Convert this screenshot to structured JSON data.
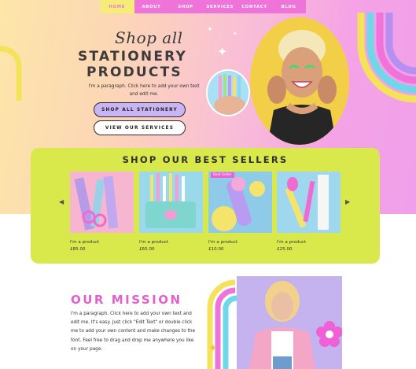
{
  "nav": {
    "items": [
      "HOME",
      "ABOUT",
      "SHOP",
      "SERVICES",
      "CONTACT",
      "BLOG"
    ],
    "active": "HOME"
  },
  "hero": {
    "script_title": "Shop all",
    "title_line1": "STATIONERY",
    "title_line2": "PRODUCTS",
    "paragraph": "I'm a paragraph. Click here to add your own text and edit me.",
    "primary_button": "SHOP ALL STATIONERY",
    "secondary_button": "VIEW OUR SERVICES"
  },
  "best_sellers": {
    "title": "SHOP OUR BEST SELLERS",
    "products": [
      {
        "name": "I'm a product",
        "price": "£85.00",
        "badge": ""
      },
      {
        "name": "I'm a product",
        "price": "£65.00",
        "badge": ""
      },
      {
        "name": "I'm a product",
        "price": "£10.00",
        "badge": "Best Seller"
      },
      {
        "name": "I'm a product",
        "price": "£25.00",
        "badge": ""
      }
    ]
  },
  "mission": {
    "title": "OUR MISSION",
    "paragraph": "I'm a paragraph. Click here to add your own text and edit me. It's easy. Just click \"Edit Text\" or double click me to add your own content and make changes to the font. Feel free to drag and drop me anywhere you like on your page."
  },
  "colors": {
    "nav_bg": "#ef74d9",
    "nav_active": "#f6ec7a",
    "sellers_bg": "#d9e94c",
    "mission_title": "#e35fcf",
    "primary_button": "#c9b4f4"
  },
  "icons": {
    "prev": "chevron-left-icon",
    "next": "chevron-right-icon",
    "sparkle": "sparkle-icon",
    "flower": "flower-icon"
  }
}
